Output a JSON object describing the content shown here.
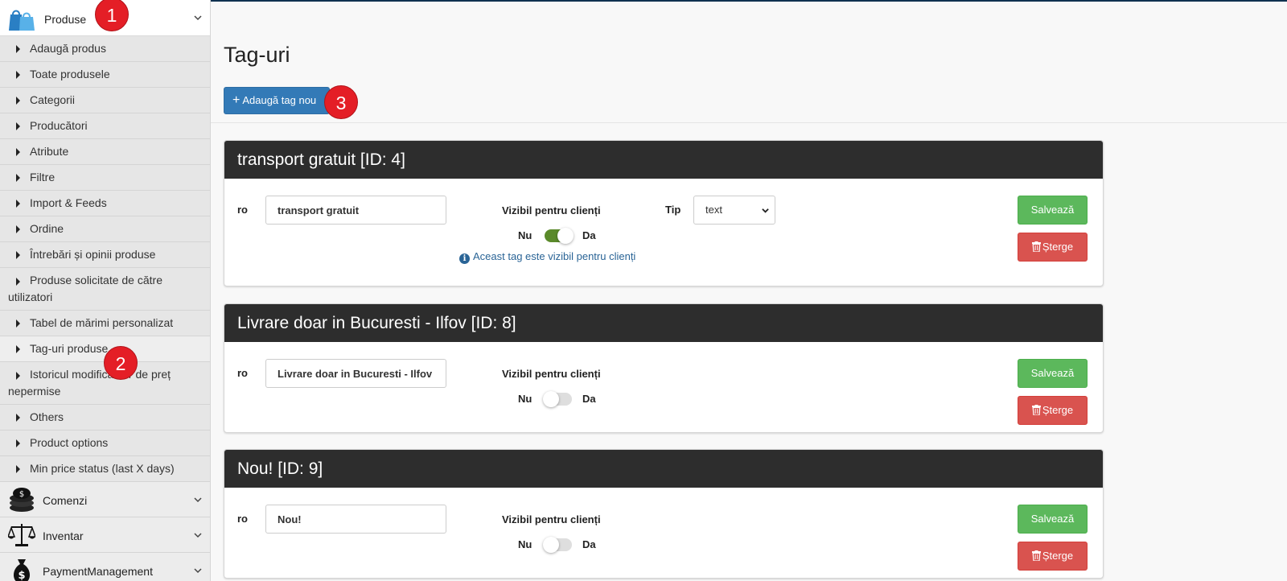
{
  "sidebar": {
    "section_title": "Produse",
    "sub_items": [
      {
        "label": "Adaugă produs"
      },
      {
        "label": "Toate produsele"
      },
      {
        "label": "Categorii"
      },
      {
        "label": "Producători"
      },
      {
        "label": "Atribute"
      },
      {
        "label": "Filtre"
      },
      {
        "label": "Import & Feeds"
      },
      {
        "label": "Ordine"
      },
      {
        "label": "Întrebări și opinii produse"
      },
      {
        "label": "Produse solicitate de către utilizatori"
      },
      {
        "label": "Tabel de mărimi personalizat"
      },
      {
        "label": "Tag-uri produse"
      },
      {
        "label": "Istoricul modificărilor de preț nepermise"
      },
      {
        "label": "Others"
      },
      {
        "label": "Product options"
      },
      {
        "label": "Min price status (last X days)"
      }
    ],
    "main_items": [
      {
        "label": "Comenzi"
      },
      {
        "label": "Inventar"
      },
      {
        "label": "PaymentManagement"
      }
    ]
  },
  "steps": [
    "1",
    "2",
    "3"
  ],
  "page": {
    "title": "Tag-uri",
    "add_button": "Adaugă tag nou"
  },
  "tag_form": {
    "lang_label": "ro",
    "visible_label": "Vizibil pentru clienți",
    "no_label": "Nu",
    "yes_label": "Da",
    "type_label": "Tip",
    "save_label": "Salvează",
    "delete_label": "Șterge",
    "visible_note": "Aceast tag este vizibil pentru clienți"
  },
  "tags": [
    {
      "header": "transport gratuit [ID: 4]",
      "value": "transport gratuit",
      "visible": true,
      "type": "text"
    },
    {
      "header": "Livrare doar in Bucuresti - Ilfov [ID: 8]",
      "value": "Livrare doar in Bucuresti - Ilfov",
      "visible": false
    },
    {
      "header": "Nou! [ID: 9]",
      "value": "Nou!",
      "visible": false
    }
  ],
  "colors": {
    "primary": "#337ab7",
    "success": "#5cb85c",
    "danger": "#d9534f",
    "toggle_on": "#5a8a2a",
    "panel_header": "#2d2d2d",
    "step_badge": "#e41e26"
  }
}
